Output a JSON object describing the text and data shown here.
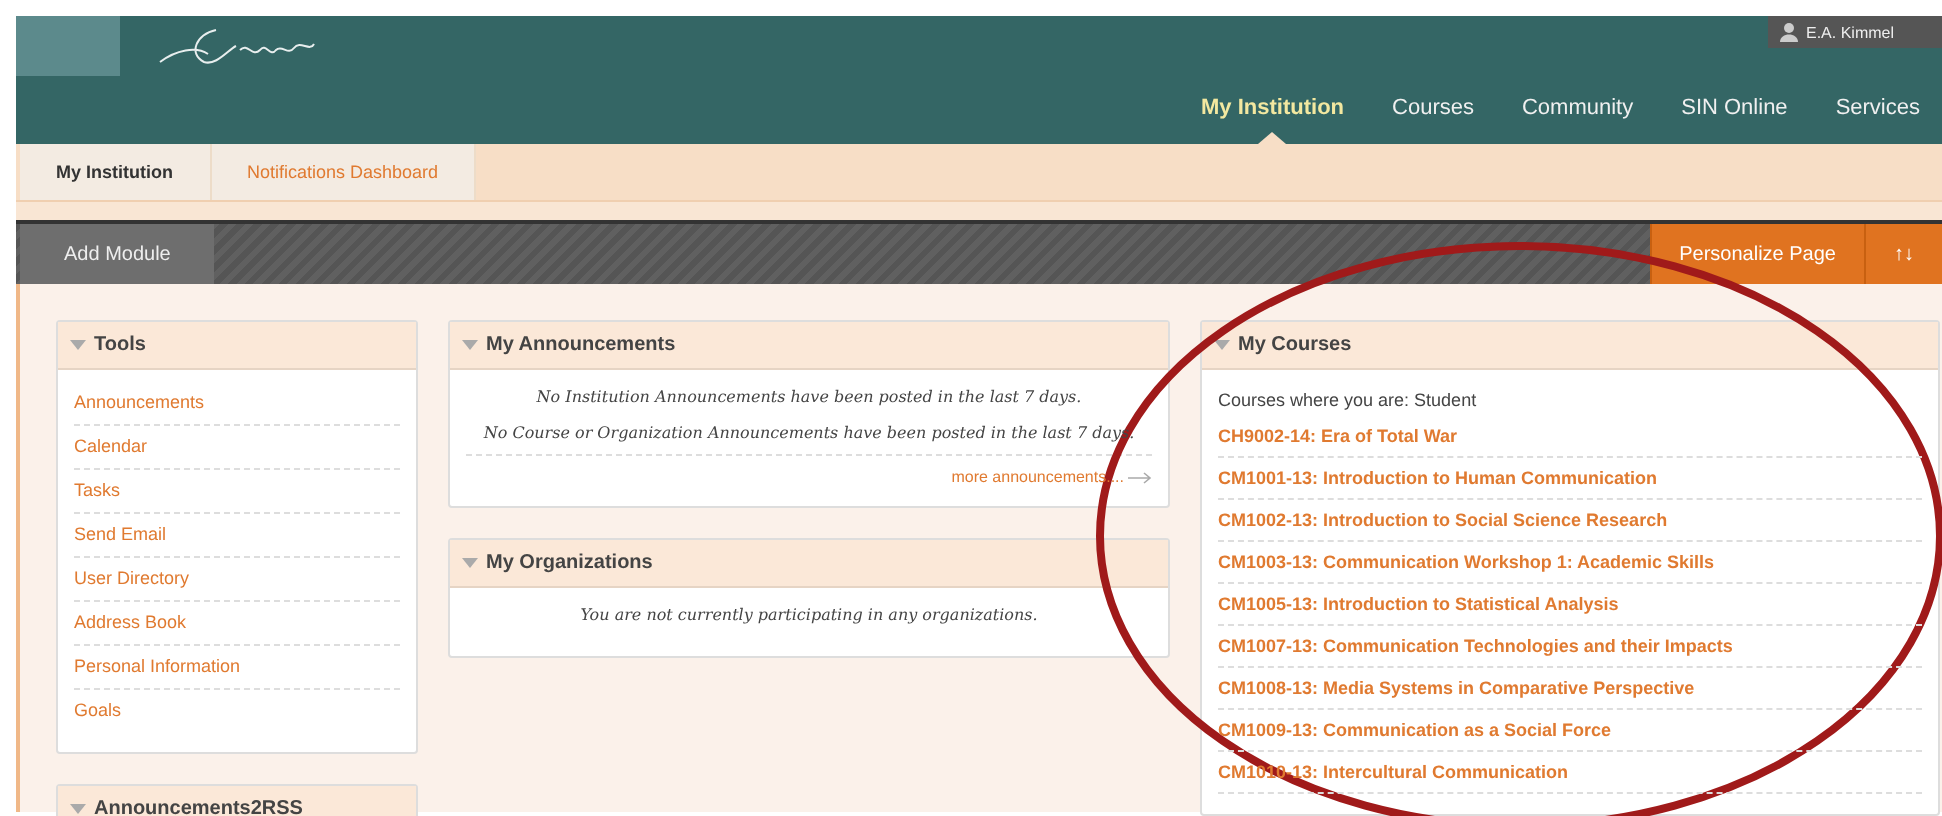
{
  "header": {
    "user_name": "E.A. Kimmel",
    "nav": [
      {
        "label": "My Institution",
        "selected": true
      },
      {
        "label": "Courses",
        "selected": false
      },
      {
        "label": "Community",
        "selected": false
      },
      {
        "label": "SIN Online",
        "selected": false
      },
      {
        "label": "Services",
        "selected": false
      }
    ]
  },
  "tabs": [
    {
      "label": "My Institution",
      "selected": true
    },
    {
      "label": "Notifications Dashboard",
      "selected": false
    }
  ],
  "toolbar": {
    "add_module": "Add Module",
    "personalize": "Personalize Page",
    "reorder": "↑↓"
  },
  "tools": {
    "title": "Tools",
    "items": [
      "Announcements",
      "Calendar",
      "Tasks",
      "Send Email",
      "User Directory",
      "Address Book",
      "Personal Information",
      "Goals"
    ]
  },
  "announcements2rss": {
    "title": "Announcements2RSS"
  },
  "my_announcements": {
    "title": "My Announcements",
    "messages": [
      "No Institution Announcements have been posted in the last 7 days.",
      "No Course or Organization Announcements have been posted in the last 7 days."
    ],
    "more_link": "more announcements...."
  },
  "my_organizations": {
    "title": "My Organizations",
    "message": "You are not currently participating in any organizations."
  },
  "my_courses": {
    "title": "My Courses",
    "role_label": "Courses where you are: Student",
    "courses": [
      "CH9002-14: Era of Total War",
      "CM1001-13: Introduction to Human Communication",
      "CM1002-13: Introduction to Social Science Research",
      "CM1003-13: Communication Workshop 1: Academic Skills",
      "CM1005-13: Introduction to Statistical Analysis",
      "CM1007-13: Communication Technologies and their Impacts",
      "CM1008-13: Media Systems in Comparative Perspective",
      "CM1009-13: Communication as a Social Force",
      "CM1010-13: Intercultural Communication"
    ]
  }
}
